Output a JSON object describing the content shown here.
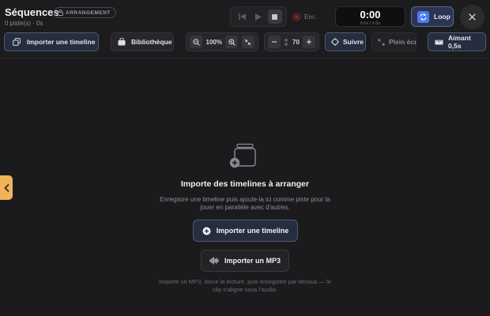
{
  "header": {
    "title": "Séquences",
    "badge": "ARRANGEMENT",
    "subtitle": "0 piste(s) · 0s"
  },
  "transport": {
    "record_label": "Enr.",
    "timer_main": "0:00",
    "timer_sub": "0.0s / 0.0s",
    "loop_label": "Loop"
  },
  "toolbar": {
    "import_timeline": "Importer une timeline",
    "library": "Bibliothèque",
    "zoom_value": "100%",
    "bpm_value": "70",
    "follow": "Suivre",
    "fullscreen": "Plein écran",
    "magnet": "Aimant 0,5s"
  },
  "empty": {
    "heading": "Importe des timelines à arranger",
    "description": "Enregistre une timeline puis ajoute-la ici comme piste pour la jouer en parallèle avec d'autres.",
    "primary_button": "Importer une timeline",
    "secondary_button": "Importer un MP3",
    "hint": "Importe un MP3, lance la lecture, puis enregistre par-dessus — le clip s'aligne sous l'audio."
  },
  "colors": {
    "background": "#1b1b1d",
    "accent_blue": "#4d7cf0",
    "side_tab": "#f0b35a",
    "record_red": "#c0392b"
  }
}
